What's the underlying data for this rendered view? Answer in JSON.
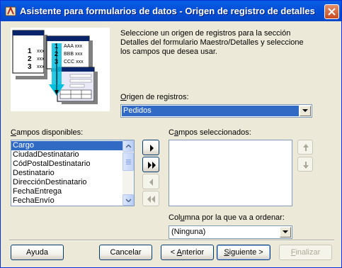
{
  "window": {
    "title": "Asistente para formularios de datos - Origen de registro de detalles"
  },
  "intro": {
    "lines": [
      "Seleccione un origen de registros para la sección",
      "Detalles del formulario Maestro/Detalles y seleccione",
      "los campos que desea usar."
    ]
  },
  "illustration": {
    "rows": [
      {
        "num": "1",
        "text": "xxx"
      },
      {
        "num": "2",
        "text": "xxx"
      },
      {
        "num": "3",
        "text": "xxx"
      }
    ],
    "rows_right": [
      "AAA xxx",
      "BBB xxx",
      "CCC xxx"
    ]
  },
  "record_source": {
    "label_key": "O",
    "label_rest": "rigen de registros:",
    "value": "Pedidos"
  },
  "available_fields": {
    "label_key": "C",
    "label_rest": "ampos disponibles:",
    "items": [
      "Cargo",
      "CiudadDestinatario",
      "CódPostalDestinatario",
      "Destinatario",
      "DirecciónDestinatario",
      "FechaEntrega",
      "FechaEnvío"
    ],
    "selected_index": 0
  },
  "selected_fields": {
    "label_pre": "C",
    "label_key": "a",
    "label_rest": "mpos seleccionados:",
    "items": []
  },
  "sort_column": {
    "label_pre": "Col",
    "label_key": "u",
    "label_rest": "mna por la que va a ordenar:",
    "value": "(Ninguna)"
  },
  "icons": {
    "move_one": "arrow-right-icon",
    "move_all": "double-arrow-right-icon",
    "remove_one": "arrow-left-icon",
    "remove_all": "double-arrow-left-icon",
    "move_up": "arrow-up-icon",
    "move_down": "arrow-down-icon"
  },
  "buttons": {
    "help": "Ayuda",
    "cancel": "Cancelar",
    "back_pre": "< ",
    "back_key": "A",
    "back_rest": "nterior",
    "next_key": "S",
    "next_rest": "iguiente >",
    "finish_key": "F",
    "finish_rest": "inalizar"
  },
  "colors": {
    "title_bar": "#0350d8",
    "selection": "#316ac5",
    "dialog_bg": "#ece9d8",
    "close_button": "#c8491f"
  }
}
